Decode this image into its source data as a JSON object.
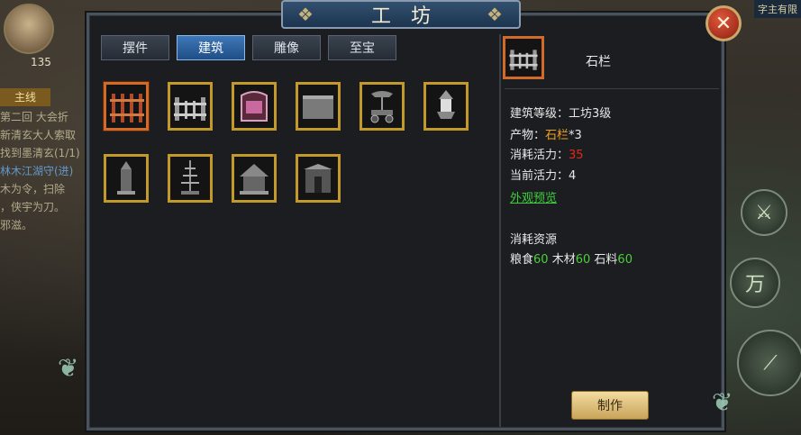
{
  "background": {
    "level": "135",
    "main_tag": "主线",
    "quest_lines": [
      "第二回 大会折",
      "新清玄大人索取",
      "",
      "找到墨清玄(1/1)",
      "林木江湖守(进)",
      "木为令，扫除",
      "，侠宇为刀。",
      "邪滋。"
    ],
    "top_right_text": "字主有限",
    "skill_glyph": "万"
  },
  "title": "工坊",
  "close_symbol": "✕",
  "tabs": [
    {
      "label": "摆件"
    },
    {
      "label": "建筑"
    },
    {
      "label": "雕像"
    },
    {
      "label": "至宝"
    }
  ],
  "active_tab": 1,
  "items": [
    {
      "icon": "fence-red-icon"
    },
    {
      "icon": "fence-stone-icon"
    },
    {
      "icon": "screen-icon"
    },
    {
      "icon": "wall-icon"
    },
    {
      "icon": "cart-icon"
    },
    {
      "icon": "lamp-icon"
    },
    {
      "icon": "pillar-icon"
    },
    {
      "icon": "pagoda-icon"
    },
    {
      "icon": "pavilion-icon"
    },
    {
      "icon": "gate-icon"
    }
  ],
  "selected_item": 1,
  "detail": {
    "name": "石栏",
    "building_level_label": "建筑等级：",
    "building_level_value": "工坊3级",
    "product_label": "产物：",
    "product_value": "石栏",
    "product_count": "*3",
    "cost_label": "消耗活力：",
    "cost_value": "35",
    "current_label": "当前活力：",
    "current_value": "4",
    "preview_link": "外观预览",
    "resources_title": "消耗资源",
    "resources": [
      {
        "name": "粮食",
        "amount": "60"
      },
      {
        "name": "木材",
        "amount": "60"
      },
      {
        "name": "石料",
        "amount": "60"
      }
    ]
  },
  "make_button": "制作",
  "colors": {
    "orange": "#f0a020",
    "red": "#e02a1a",
    "green": "#4ccf3a",
    "gold_border": "#c39a2a",
    "selected_border": "#d26a2a"
  }
}
